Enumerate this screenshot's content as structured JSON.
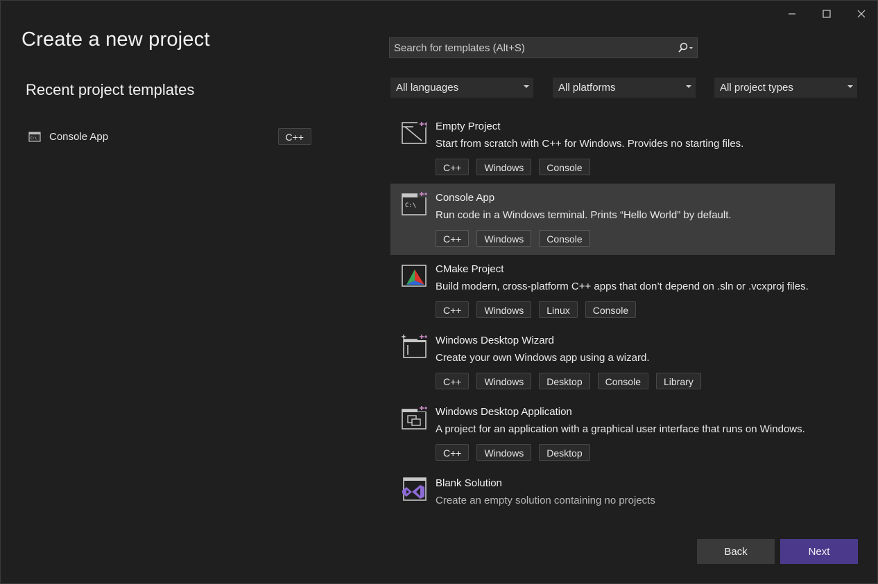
{
  "window": {
    "title": "Create a new project",
    "controls": [
      "minimize-icon",
      "maximize-icon",
      "close-icon"
    ]
  },
  "recent": {
    "heading": "Recent project templates",
    "items": [
      {
        "name": "Console App",
        "tag": "C++",
        "icon": "console-app-icon"
      }
    ]
  },
  "search": {
    "placeholder": "Search for templates (Alt+S)",
    "value": "",
    "icon": "search-icon"
  },
  "filters": {
    "language": "All languages",
    "platform": "All platforms",
    "project_type": "All project types"
  },
  "templates": [
    {
      "name": "Empty Project",
      "description": "Start from scratch with C++ for Windows. Provides no starting files.",
      "tags": [
        "C++",
        "Windows",
        "Console"
      ],
      "icon": "empty-project-icon",
      "selected": false
    },
    {
      "name": "Console App",
      "description": "Run code in a Windows terminal. Prints “Hello World” by default.",
      "tags": [
        "C++",
        "Windows",
        "Console"
      ],
      "icon": "console-app-icon",
      "selected": true
    },
    {
      "name": "CMake Project",
      "description": "Build modern, cross-platform C++ apps that don’t depend on .sln or .vcxproj files.",
      "tags": [
        "C++",
        "Windows",
        "Linux",
        "Console"
      ],
      "icon": "cmake-icon",
      "selected": false
    },
    {
      "name": "Windows Desktop Wizard",
      "description": "Create your own Windows app using a wizard.",
      "tags": [
        "C++",
        "Windows",
        "Desktop",
        "Console",
        "Library"
      ],
      "icon": "desktop-wizard-icon",
      "selected": false
    },
    {
      "name": "Windows Desktop Application",
      "description": "A project for an application with a graphical user interface that runs on Windows.",
      "tags": [
        "C++",
        "Windows",
        "Desktop"
      ],
      "icon": "desktop-application-icon",
      "selected": false
    },
    {
      "name": "Blank Solution",
      "description": "Create an empty solution containing no projects",
      "tags": [],
      "icon": "blank-solution-icon",
      "selected": false
    }
  ],
  "buttons": {
    "back": "Back",
    "next": "Next"
  },
  "colors": {
    "background": "#1f1f1f",
    "accent": "#4b3a8c",
    "selected_row": "#3d3d3d"
  }
}
